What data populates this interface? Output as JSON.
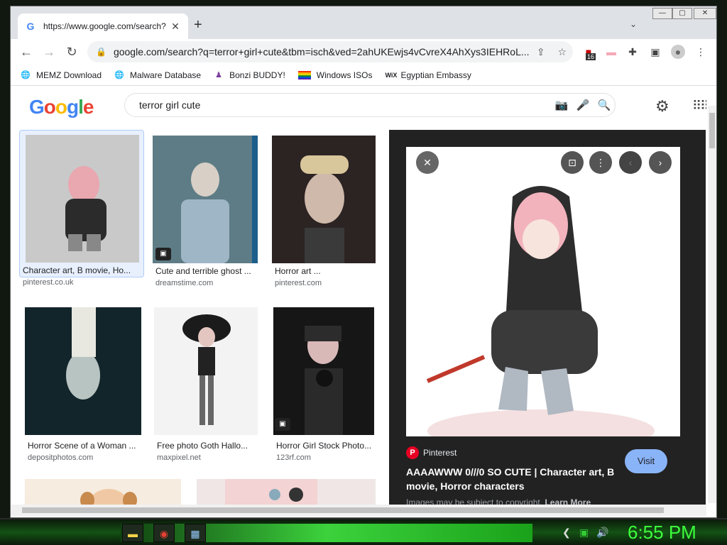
{
  "tab": {
    "title": "https://www.google.com/search?",
    "close": "✕"
  },
  "window_controls": [
    "—",
    "▢",
    "✕"
  ],
  "address": {
    "url": "google.com/search?q=terror+girl+cute&tbm=isch&ved=2ahUKEwjs4vCvreX4AhXys3IEHRoL..."
  },
  "extensions": {
    "badge_count": "16"
  },
  "bookmarks": [
    {
      "label": "MEMZ Download",
      "icon": "globe-icon"
    },
    {
      "label": "Malware Database",
      "icon": "globe-icon"
    },
    {
      "label": "Bonzi BUDDY!",
      "icon": "bonzi-icon"
    },
    {
      "label": "Windows ISOs",
      "icon": "rainbow-flag-icon"
    },
    {
      "label": "Egyptian Embassy",
      "icon": "wix-icon"
    }
  ],
  "search": {
    "query": "terror girl cute"
  },
  "results": [
    {
      "caption": "Character art, B movie, Ho...",
      "source": "pinterest.co.uk"
    },
    {
      "caption": "Cute and terrible ghost ...",
      "source": "dreamstime.com"
    },
    {
      "caption": "Horror art ...",
      "source": "pinterest.com"
    },
    {
      "caption": "Horror Scene of a Woman ...",
      "source": "depositphotos.com"
    },
    {
      "caption": "Free photo Goth Hallo...",
      "source": "maxpixel.net"
    },
    {
      "caption": "Horror Girl Stock Photo...",
      "source": "123rf.com"
    }
  ],
  "preview": {
    "site": "Pinterest",
    "title": "AAAAWWW 0///0 SO CUTE | Character art, B movie, Horror characters",
    "visit_label": "Visit",
    "copyright": "Images may be subject to copyright.",
    "learn_more": "Learn More"
  },
  "taskbar": {
    "clock": "6:55 PM"
  }
}
